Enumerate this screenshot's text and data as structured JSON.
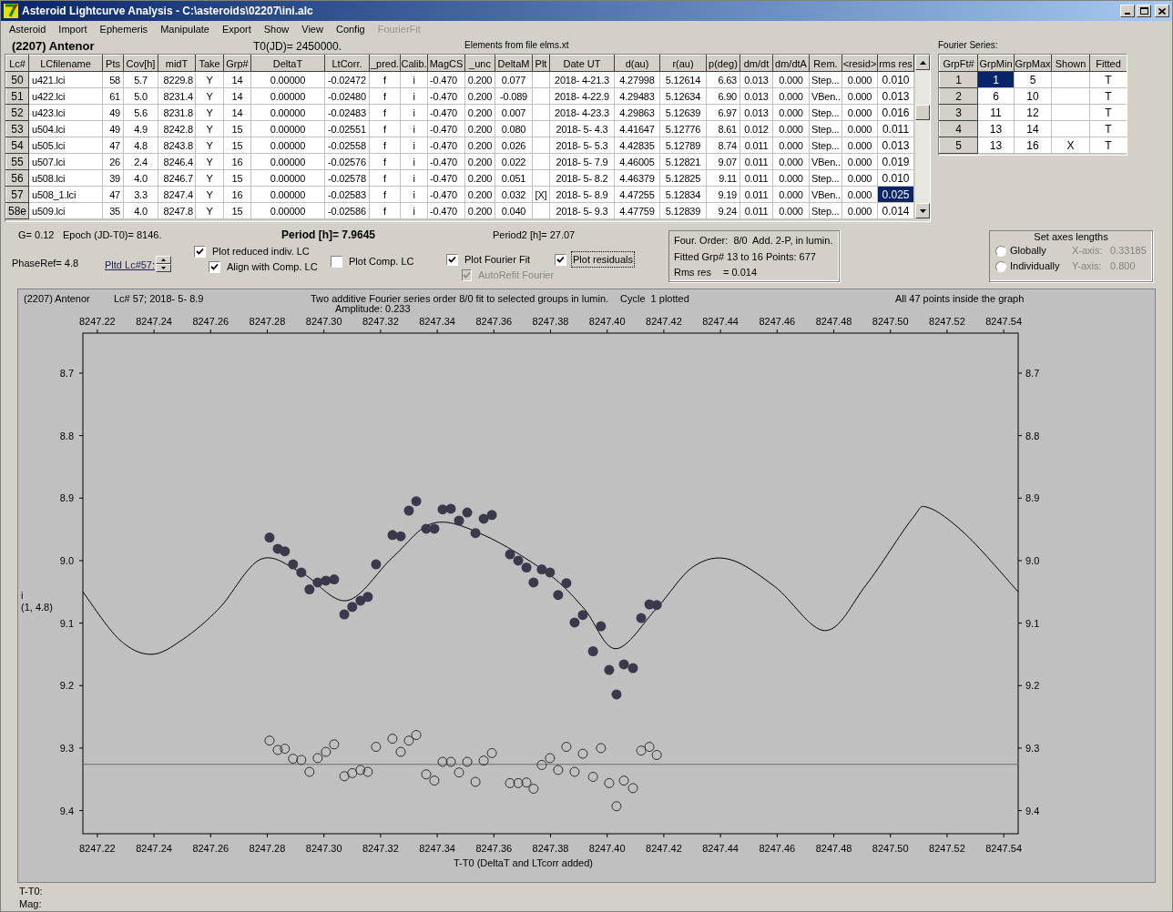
{
  "window": {
    "title": "Asteroid Lightcurve Analysis - C:\\asteroids\\02207\\ini.alc"
  },
  "menu": [
    {
      "label": "Asteroid",
      "disabled": false
    },
    {
      "label": "Import",
      "disabled": false
    },
    {
      "label": "Ephemeris",
      "disabled": false
    },
    {
      "label": "Manipulate",
      "disabled": false
    },
    {
      "label": "Export",
      "disabled": false
    },
    {
      "label": "Show",
      "disabled": false
    },
    {
      "label": "View",
      "disabled": false
    },
    {
      "label": "Config",
      "disabled": false
    },
    {
      "label": "FourierFit",
      "disabled": true
    }
  ],
  "header": {
    "asteroid": "(2207) Antenor",
    "t0": "T0(JD)= 2450000.",
    "elements": "Elements from file elms.xt",
    "fourier_title": "Fourier Series:"
  },
  "lc_table": {
    "columns": [
      "Lc#",
      "LCfilename",
      "Pts",
      "Cov[h]",
      "midT",
      "Take",
      "Grp#",
      "DeltaT",
      "LtCorr.",
      "_pred.",
      "Calib.",
      "MagCS",
      "_unc",
      "DeltaM",
      "Plt",
      "Date UT",
      "d(au)",
      "r(au)",
      "p(deg)",
      "dm/dt",
      "dm/dtA",
      "Rem.",
      "<resid>",
      "rms res"
    ],
    "rows": [
      {
        "lc": "50",
        "file": "u421.lci",
        "pts": "58",
        "cov": "5.7",
        "midt": "8229.8",
        "take": "Y",
        "grp": "14",
        "dt": "0.00000",
        "lt": "-0.02472",
        "pred": "f",
        "calib": "i",
        "magcs": "-0.470",
        "unc": "0.200",
        "dm": "0.077",
        "date": "2018- 4-21.3",
        "d": "4.27998",
        "r": "5.12614",
        "p": "6.63",
        "dmdt": "0.013",
        "dmdta": "0.000",
        "rem": "Step...",
        "resid": "0.000",
        "rms": {
          "text": "0.010",
          "selected": false
        }
      },
      {
        "lc": "51",
        "file": "u422.lci",
        "pts": "61",
        "cov": "5.0",
        "midt": "8231.4",
        "take": "Y",
        "grp": "14",
        "dt": "0.00000",
        "lt": "-0.02480",
        "pred": "f",
        "calib": "i",
        "magcs": "-0.470",
        "unc": "0.200",
        "dm": "-0.089",
        "date": "2018- 4-22.9",
        "d": "4.29483",
        "r": "5.12634",
        "p": "6.90",
        "dmdt": "0.013",
        "dmdta": "0.000",
        "rem": "VBen..",
        "resid": "0.000",
        "rms": {
          "text": "0.013",
          "selected": false
        }
      },
      {
        "lc": "52",
        "file": "u423.lci",
        "pts": "49",
        "cov": "5.6",
        "midt": "8231.8",
        "take": "Y",
        "grp": "14",
        "dt": "0.00000",
        "lt": "-0.02483",
        "pred": "f",
        "calib": "i",
        "magcs": "-0.470",
        "unc": "0.200",
        "dm": "0.007",
        "date": "2018- 4-23.3",
        "d": "4.29863",
        "r": "5.12639",
        "p": "6.97",
        "dmdt": "0.013",
        "dmdta": "0.000",
        "rem": "Step...",
        "resid": "0.000",
        "rms": {
          "text": "0.016",
          "selected": false
        }
      },
      {
        "lc": "53",
        "file": "u504.lci",
        "pts": "49",
        "cov": "4.9",
        "midt": "8242.8",
        "take": "Y",
        "grp": "15",
        "dt": "0.00000",
        "lt": "-0.02551",
        "pred": "f",
        "calib": "i",
        "magcs": "-0.470",
        "unc": "0.200",
        "dm": "0.080",
        "date": "2018- 5- 4.3",
        "d": "4.41647",
        "r": "5.12776",
        "p": "8.61",
        "dmdt": "0.012",
        "dmdta": "0.000",
        "rem": "Step...",
        "resid": "0.000",
        "rms": {
          "text": "0.011",
          "selected": false
        }
      },
      {
        "lc": "54",
        "file": "u505.lci",
        "pts": "47",
        "cov": "4.8",
        "midt": "8243.8",
        "take": "Y",
        "grp": "15",
        "dt": "0.00000",
        "lt": "-0.02558",
        "pred": "f",
        "calib": "i",
        "magcs": "-0.470",
        "unc": "0.200",
        "dm": "0.026",
        "date": "2018- 5- 5.3",
        "d": "4.42835",
        "r": "5.12789",
        "p": "8.74",
        "dmdt": "0.011",
        "dmdta": "0.000",
        "rem": "Step...",
        "resid": "0.000",
        "rms": {
          "text": "0.013",
          "selected": false
        }
      },
      {
        "lc": "55",
        "file": "u507.lci",
        "pts": "26",
        "cov": "2.4",
        "midt": "8246.4",
        "take": "Y",
        "grp": "16",
        "dt": "0.00000",
        "lt": "-0.02576",
        "pred": "f",
        "calib": "i",
        "magcs": "-0.470",
        "unc": "0.200",
        "dm": "0.022",
        "date": "2018- 5- 7.9",
        "d": "4.46005",
        "r": "5.12821",
        "p": "9.07",
        "dmdt": "0.011",
        "dmdta": "0.000",
        "rem": "VBen..",
        "resid": "0.000",
        "rms": {
          "text": "0.019",
          "selected": false
        }
      },
      {
        "lc": "56",
        "file": "u508.lci",
        "pts": "39",
        "cov": "4.0",
        "midt": "8246.7",
        "take": "Y",
        "grp": "15",
        "dt": "0.00000",
        "lt": "-0.02578",
        "pred": "f",
        "calib": "i",
        "magcs": "-0.470",
        "unc": "0.200",
        "dm": "0.051",
        "date": "2018- 5- 8.2",
        "d": "4.46379",
        "r": "5.12825",
        "p": "9.11",
        "dmdt": "0.011",
        "dmdta": "0.000",
        "rem": "Step...",
        "resid": "0.000",
        "rms": {
          "text": "0.010",
          "selected": false
        }
      },
      {
        "lc": "57",
        "file": "u508_1.lci",
        "pts": "47",
        "cov": "3.3",
        "midt": "8247.4",
        "take": "Y",
        "grp": "16",
        "dt": "0.00000",
        "lt": "-0.02583",
        "pred": "f",
        "calib": "i",
        "magcs": "-0.470",
        "unc": "0.200",
        "dm": "0.032",
        "plt": "[X]",
        "date": "2018- 5- 8.9",
        "d": "4.47255",
        "r": "5.12834",
        "p": "9.19",
        "dmdt": "0.011",
        "dmdta": "0.000",
        "rem": "VBen..",
        "resid": "0.000",
        "rms": {
          "text": "0.025",
          "selected": true
        }
      },
      {
        "lc": "58e",
        "file": "u509.lci",
        "pts": "35",
        "cov": "4.0",
        "midt": "8247.8",
        "take": "Y",
        "grp": "15",
        "dt": "0.00000",
        "lt": "-0.02586",
        "pred": "f",
        "calib": "i",
        "magcs": "-0.470",
        "unc": "0.200",
        "dm": "0.040",
        "date": "2018- 5- 9.3",
        "d": "4.47759",
        "r": "5.12839",
        "p": "9.24",
        "dmdt": "0.011",
        "dmdta": "0.000",
        "rem": "Step...",
        "resid": "0.000",
        "rms": {
          "text": "0.014",
          "selected": false
        }
      }
    ]
  },
  "fourier_table": {
    "columns": [
      "GrpFt#",
      "GrpMin",
      "GrpMax",
      "Shown",
      "Fitted"
    ],
    "rows": [
      {
        "header": "1",
        "grp_min": {
          "text": "1",
          "selected": true
        },
        "grp_max": "5",
        "fitted": "T"
      },
      {
        "header": "2",
        "grp_min": {
          "text": "6",
          "selected": false
        },
        "grp_max": "10",
        "fitted": "T"
      },
      {
        "header": "3",
        "grp_min": {
          "text": "11",
          "selected": false
        },
        "grp_max": "12",
        "fitted": "T"
      },
      {
        "header": "4",
        "grp_min": {
          "text": "13",
          "selected": false
        },
        "grp_max": "14",
        "fitted": "T"
      },
      {
        "header": "5",
        "grp_min": {
          "text": "13",
          "selected": false
        },
        "grp_max": "16",
        "shown": "X",
        "fitted": "T"
      }
    ]
  },
  "info": {
    "g": "G= 0.12",
    "epoch": "Epoch (JD-T0)= 8146.",
    "period": "Period [h]= 7.9645",
    "period2": "Period2 [h]= 27.07",
    "phase_ref": "PhaseRef= 4.8",
    "plotted_lc_link": "Pltd Lc#57:"
  },
  "options": {
    "reduced": {
      "label": "Plot reduced indiv. LC",
      "checked": true,
      "disabled": false,
      "focused": false
    },
    "align": {
      "label": "Align with Comp. LC",
      "checked": true,
      "disabled": false,
      "focused": false
    },
    "comp": {
      "label": "Plot Comp. LC",
      "checked": false,
      "disabled": false,
      "focused": false
    },
    "fourier_fit": {
      "label": "Plot Fourier Fit",
      "checked": true,
      "disabled": false,
      "focused": false
    },
    "autorefit": {
      "label": "AutoRefit Fourier",
      "checked": true,
      "disabled": true,
      "focused": false
    },
    "residuals": {
      "label": "Plot residuals",
      "checked": true,
      "disabled": false,
      "focused": true
    }
  },
  "fit_summary": {
    "order": "Four. Order:  8/0",
    "mode": "Add. 2-P, in lumin.",
    "fitted": "Fitted Grp# 13 to 16 Points: 677",
    "rms_label": "Rms res",
    "rms_value": "= 0.014"
  },
  "axes_lengths": {
    "title": "Set axes lengths",
    "options": [
      {
        "label": "Globally",
        "selected": false,
        "axis_label": "X-axis:",
        "axis_value": "0.33185",
        "disabled": true
      },
      {
        "label": "Individually",
        "selected": false,
        "axis_label": "Y-axis:",
        "axis_value": "0.800",
        "disabled": true
      }
    ]
  },
  "plot": {
    "object": "(2207) Antenor",
    "lc": "Lc# 57; 2018- 5- 8.9",
    "description": "Two additive Fourier series order 8/0 fit to selected groups in lumin.",
    "amplitude": "Amplitude: 0.233",
    "cycle": "Cycle  1 plotted",
    "points_note": "All 47 points inside the graph",
    "y_quantity": "i",
    "y_scale_note": "(1, 4.8)",
    "chart_data": {
      "type": "scatter",
      "xlabel": "T-T0 (DeltaT and LTcorr added)",
      "xlim": [
        8247.2149,
        8247.5451
      ],
      "ylim": [
        9.437,
        8.636
      ],
      "xticks": [
        {
          "value": 8247.22,
          "label": "8247.22"
        },
        {
          "value": 8247.24,
          "label": "8247.24"
        },
        {
          "value": 8247.26,
          "label": "8247.26"
        },
        {
          "value": 8247.28,
          "label": "8247.28"
        },
        {
          "value": 8247.3,
          "label": "8247.30"
        },
        {
          "value": 8247.32,
          "label": "8247.32"
        },
        {
          "value": 8247.34,
          "label": "8247.34"
        },
        {
          "value": 8247.36,
          "label": "8247.36"
        },
        {
          "value": 8247.38,
          "label": "8247.38"
        },
        {
          "value": 8247.4,
          "label": "8247.40"
        },
        {
          "value": 8247.42,
          "label": "8247.42"
        },
        {
          "value": 8247.44,
          "label": "8247.44"
        },
        {
          "value": 8247.46,
          "label": "8247.46"
        },
        {
          "value": 8247.48,
          "label": "8247.48"
        },
        {
          "value": 8247.5,
          "label": "8247.50"
        },
        {
          "value": 8247.52,
          "label": "8247.52"
        },
        {
          "value": 8247.54,
          "label": "8247.54"
        }
      ],
      "yticks": [
        {
          "value": 8.7,
          "label": "8.7"
        },
        {
          "value": 8.8,
          "label": "8.8"
        },
        {
          "value": 8.9,
          "label": "8.9"
        },
        {
          "value": 9.0,
          "label": "9.0"
        },
        {
          "value": 9.1,
          "label": "9.1"
        },
        {
          "value": 9.2,
          "label": "9.2"
        },
        {
          "value": 9.3,
          "label": "9.3"
        },
        {
          "value": 9.4,
          "label": "9.4"
        }
      ],
      "ref_lines": [
        {
          "axis": "y",
          "value": 9.326,
          "color": "#6e6e6e"
        }
      ],
      "x": [
        8247.2149,
        8247.2277,
        8247.239,
        8247.2502,
        8247.2631,
        8247.2776,
        8247.2808,
        8247.2837,
        8247.2862,
        8247.2891,
        8247.292,
        8247.2949,
        8247.2978,
        8247.3007,
        8247.3036,
        8247.3072,
        8247.3081,
        8247.31,
        8247.3129,
        8247.3155,
        8247.3184,
        8247.3242,
        8247.3271,
        8247.33,
        8247.3326,
        8247.3361,
        8247.3387,
        8247.339,
        8247.3419,
        8247.3448,
        8247.3477,
        8247.3506,
        8247.3535,
        8247.3564,
        8247.3593,
        8247.3657,
        8247.3686,
        8247.3715,
        8247.374,
        8247.3769,
        8247.3789,
        8247.3798,
        8247.3827,
        8247.3856,
        8247.3885,
        8247.3914,
        8247.3917,
        8247.395,
        8247.3978,
        8247.4007,
        8247.403,
        8247.4033,
        8247.4059,
        8247.4091,
        8247.412,
        8247.4149,
        8247.4175,
        8247.4303,
        8247.4432,
        8247.4593,
        8247.477,
        8247.4914,
        8247.5075,
        8247.5133,
        8247.5268,
        8247.5451
      ],
      "series": [
        {
          "type": "line",
          "color": "#000000",
          "values": [
            9.05,
            9.126,
            9.15,
            9.126,
            9.076,
            8.998,
            null,
            null,
            null,
            null,
            9.019,
            null,
            null,
            null,
            null,
            null,
            9.064,
            null,
            null,
            null,
            null,
            8.995,
            null,
            null,
            null,
            null,
            8.94,
            null,
            null,
            null,
            null,
            null,
            null,
            8.959,
            null,
            null,
            null,
            null,
            null,
            null,
            9.02,
            null,
            null,
            null,
            null,
            null,
            9.076,
            null,
            null,
            null,
            9.141,
            null,
            null,
            null,
            null,
            null,
            9.076,
            9.01,
            8.998,
            9.042,
            9.112,
            9.039,
            8.934,
            8.915,
            8.959,
            9.05
          ]
        },
        {
          "color": "#3a3a4c",
          "values": [
            null,
            null,
            null,
            null,
            null,
            null,
            8.963,
            8.981,
            8.985,
            9.006,
            9.019,
            9.046,
            9.035,
            9.032,
            9.03,
            9.086,
            null,
            9.074,
            9.064,
            9.058,
            9.006,
            8.959,
            8.961,
            8.92,
            8.905,
            8.949,
            null,
            8.949,
            8.918,
            8.917,
            8.936,
            8.923,
            8.956,
            8.933,
            8.927,
            8.99,
            9.0,
            9.011,
            9.035,
            9.014,
            null,
            9.019,
            9.055,
            9.036,
            9.099,
            9.087,
            null,
            9.145,
            9.105,
            9.175,
            null,
            9.214,
            9.166,
            9.172,
            9.092,
            9.07,
            9.071,
            null,
            null,
            null,
            null,
            null,
            null,
            null,
            null,
            null
          ]
        },
        {
          "color": "#303030",
          "values": [
            null,
            null,
            null,
            null,
            null,
            null,
            9.288,
            9.303,
            9.301,
            9.317,
            9.319,
            9.338,
            9.316,
            9.306,
            9.294,
            9.345,
            null,
            9.34,
            9.335,
            9.338,
            9.298,
            9.285,
            9.306,
            9.288,
            9.279,
            9.342,
            null,
            9.352,
            9.322,
            9.322,
            9.339,
            9.322,
            9.354,
            9.32,
            9.308,
            9.356,
            9.356,
            9.355,
            9.365,
            9.327,
            null,
            9.316,
            9.335,
            9.298,
            9.338,
            9.309,
            null,
            9.346,
            9.3,
            9.356,
            null,
            9.393,
            9.352,
            9.364,
            9.304,
            9.298,
            9.311,
            null,
            null,
            null,
            null,
            null,
            null,
            null,
            null,
            null
          ]
        }
      ]
    }
  },
  "status": {
    "t_label": "T-T0:",
    "mag_label": "Mag:"
  }
}
